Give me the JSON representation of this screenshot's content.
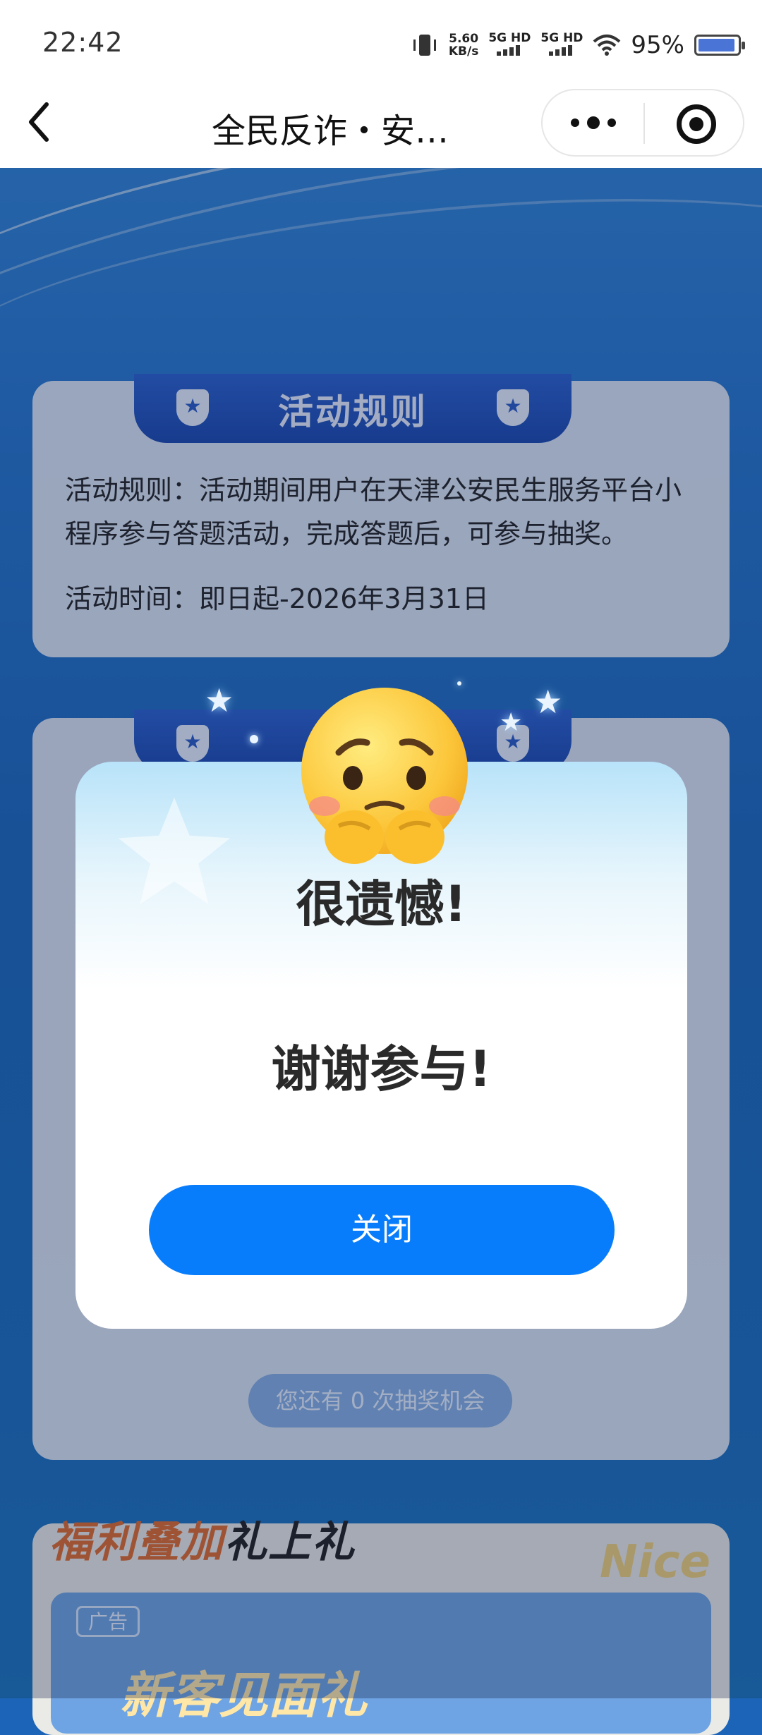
{
  "status_bar": {
    "time": "22:42",
    "net_speed_value": "5.60",
    "net_speed_unit": "KB/s",
    "sim1_label": "5G HD",
    "sim2_label": "5G HD",
    "battery_percent": "95%",
    "battery_level": 0.95
  },
  "nav": {
    "title": "全民反诈・安…"
  },
  "rules_card": {
    "tab_title": "活动规则",
    "rule_text": "活动规则：活动期间用户在天津公安民生服务平台小程序参与答题活动，完成答题后，可参与抽奖。",
    "time_text": "活动时间：即日起-2026年3月31日"
  },
  "lottery": {
    "chances_text": "您还有 0 次抽奖机会"
  },
  "welfare": {
    "title_part1": "福利叠加",
    "title_part2": "礼上礼",
    "nice_text": "Nice",
    "ad_badge": "广告",
    "ad_headline": "新客见面礼"
  },
  "modal": {
    "title": "很遗憾!",
    "message": "谢谢参与!",
    "close_label": "关闭"
  },
  "colors": {
    "primary_button": "#087dfb",
    "tab_blue": "#1a47ae",
    "page_blue": "#1c67bc"
  }
}
